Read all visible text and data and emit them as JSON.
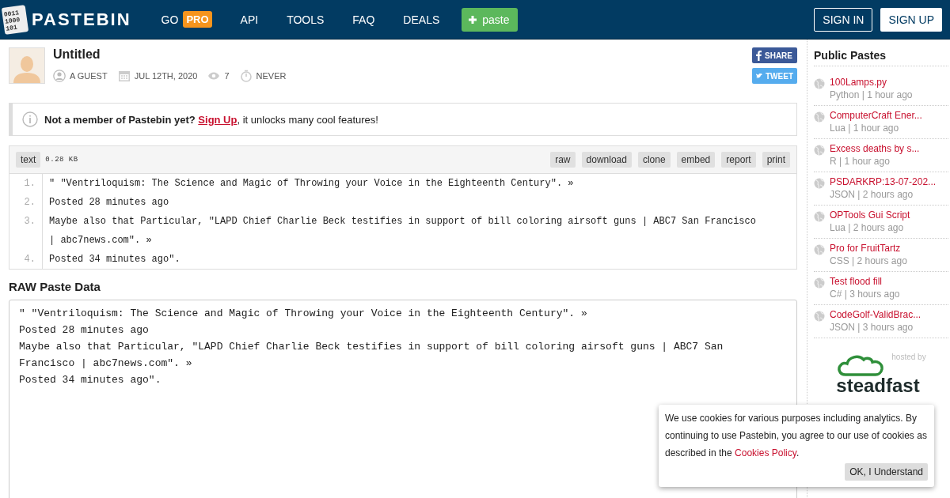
{
  "header": {
    "logo_digits": [
      "0011",
      "1000",
      "101"
    ],
    "brand": "PASTEBIN",
    "nav": [
      {
        "label": "GO",
        "badge": "PRO"
      },
      {
        "label": "API"
      },
      {
        "label": "TOOLS"
      },
      {
        "label": "FAQ"
      },
      {
        "label": "DEALS"
      }
    ],
    "paste_button": "paste",
    "sign_in": "SIGN IN",
    "sign_up": "SIGN UP"
  },
  "paste": {
    "title": "Untitled",
    "author": "A GUEST",
    "date": "JUL 12TH, 2020",
    "views": "7",
    "expires": "NEVER",
    "share": "SHARE",
    "tweet": "TWEET"
  },
  "notice": {
    "text": "Not a member of Pastebin yet?",
    "link": "Sign Up",
    "rest": ", it unlocks many cool features!"
  },
  "code": {
    "syntax": "text",
    "size": "0.28 KB",
    "actions": [
      "raw",
      "download",
      "clone",
      "embed",
      "report",
      "print"
    ],
    "lines": [
      {
        "number": "1.",
        "text": "\" \"Ventriloquism: The Science and Magic of Throwing your Voice in the Eighteenth Century\". »"
      },
      {
        "number": "2.",
        "text": "Posted 28 minutes ago"
      },
      {
        "number": "3.",
        "text": "Maybe also that Particular, \"LAPD Chief Charlie Beck testifies in support of bill coloring airsoft guns | ABC7 San Francisco | abc7news.com\". »"
      },
      {
        "number": "4.",
        "text": "Posted 34 minutes ago\"."
      }
    ]
  },
  "raw": {
    "heading": "RAW Paste Data",
    "lines": [
      "\" \"Ventriloquism: The Science and Magic of Throwing your Voice in the Eighteenth Century\". »",
      "Posted 28 minutes ago",
      "Maybe also that Particular, \"LAPD Chief Charlie Beck testifies in support of bill coloring airsoft guns | ABC7 San Francisco | abc7news.com\". »",
      "Posted 34 minutes ago\"."
    ]
  },
  "sidebar": {
    "heading": "Public Pastes",
    "items": [
      {
        "title": "100Lamps.py",
        "meta": "Python | 1 hour ago"
      },
      {
        "title": "ComputerCraft Ener...",
        "meta": "Lua | 1 hour ago"
      },
      {
        "title": "Excess deaths by s...",
        "meta": "R | 1 hour ago"
      },
      {
        "title": "PSDARKRP:13-07-202...",
        "meta": "JSON | 2 hours ago"
      },
      {
        "title": "OPTools Gui Script",
        "meta": "Lua | 2 hours ago"
      },
      {
        "title": "Pro for FruitTartz",
        "meta": "CSS | 2 hours ago"
      },
      {
        "title": "Test flood fill",
        "meta": "C# | 3 hours ago"
      },
      {
        "title": "CodeGolf-ValidBrac...",
        "meta": "JSON | 3 hours ago"
      }
    ],
    "hosted_by": "hosted by",
    "host": "steadfast"
  },
  "cookie": {
    "text": "We use cookies for various purposes including analytics. By continuing to use Pastebin, you agree to our use of cookies as described in the",
    "link": "Cookies Policy",
    "after": ".",
    "button": "OK, I Understand"
  }
}
